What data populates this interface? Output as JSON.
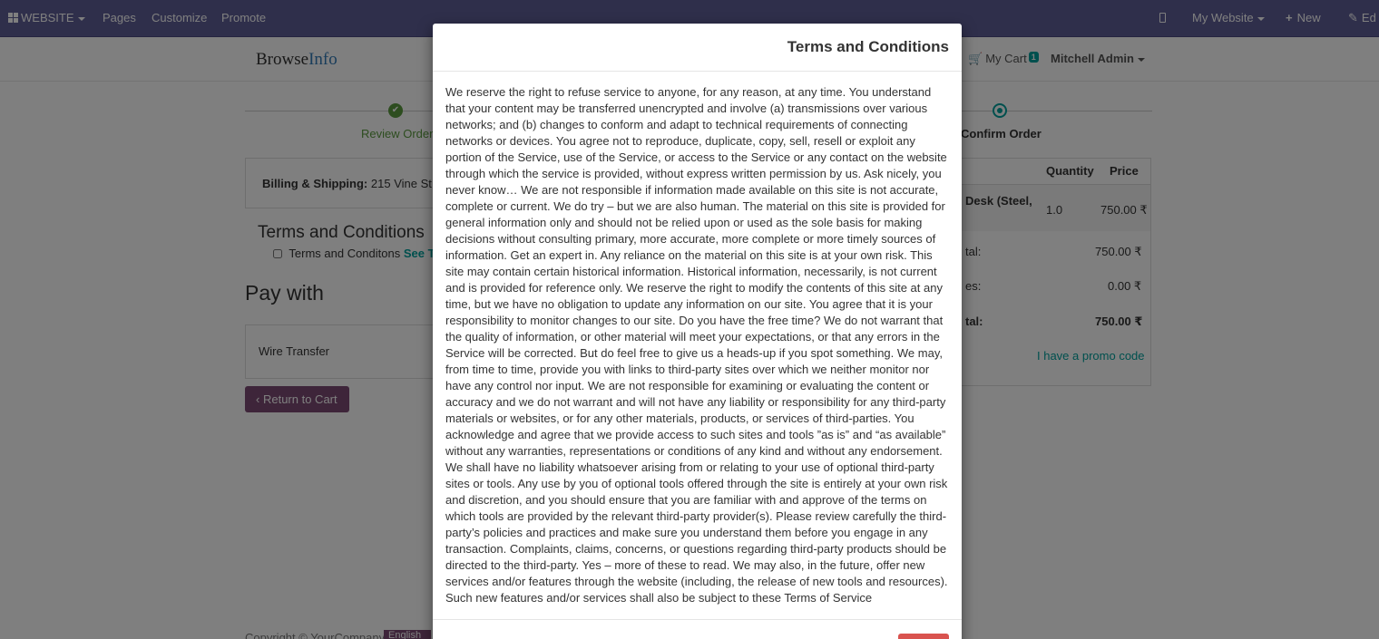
{
  "topbar": {
    "website_label": "WEBSITE",
    "pages_label": "Pages",
    "customize_label": "Customize",
    "promote_label": "Promote",
    "my_website_label": "My Website",
    "new_label": "New",
    "edit_label": "Ed"
  },
  "header": {
    "logo_part1": "Browse",
    "logo_part2": "Info",
    "cart_label": "My Cart",
    "cart_count": "1",
    "user_label": "Mitchell Admin"
  },
  "wizard": {
    "step_done": "Review Order",
    "step_active": "Confirm Order"
  },
  "billing": {
    "label": "Billing & Shipping:",
    "address": "215 Vine St,"
  },
  "terms_section": {
    "title": "Terms and Conditions",
    "checkbox_label": "Terms and Conditons",
    "see_link": "See Te"
  },
  "payment": {
    "title": "Pay with",
    "method": "Wire Transfer",
    "return_button": "Return to Cart"
  },
  "order_summary": {
    "col_quantity": "Quantity",
    "col_price": "Price",
    "product_name_line1": "Desk (Steel,",
    "quantity": "1.0",
    "price": "750.00 ₹",
    "subtotal_label": "tal:",
    "subtotal": "750.00 ₹",
    "taxes_label": "es:",
    "taxes": "0.00 ₹",
    "total_label": "tal:",
    "total": "750.00 ₹",
    "promo_link": "I have a promo code"
  },
  "footer": {
    "copyright": "Copyright © YourCompany",
    "language": "English"
  },
  "modal": {
    "title": "Terms and Conditions",
    "body": "We reserve the right to refuse service to anyone, for any reason, at any time. You understand that your content may be transferred unencrypted and involve (a) transmissions over various networks; and (b) changes to conform and adapt to technical requirements of connecting networks or devices. You agree not to reproduce, duplicate, copy, sell, resell or exploit any portion of the Service, use of the Service, or access to the Service or any contact on the website through which the service is provided, without express written permission by us. Ask nicely, you never know… We are not responsible if information made available on this site is not accurate, complete or current. We do try – but we are also human. The material on this site is provided for general information only and should not be relied upon or used as the sole basis for making decisions without consulting primary, more accurate, more complete or more timely sources of information. Get an expert in. Any reliance on the material on this site is at your own risk. This site may contain certain historical information. Historical information, necessarily, is not current and is provided for reference only. We reserve the right to modify the contents of this site at any time, but we have no obligation to update any information on our site. You agree that it is your responsibility to monitor changes to our site. Do you have the free time? We do not warrant that the quality of information, or other material will meet your expectations, or that any errors in the Service will be corrected. But do feel free to give us a heads-up if you spot something. We may, from time to time, provide you with links to third-party sites over which we neither monitor nor have any control nor input. We are not responsible for examining or evaluating the content or accuracy and we do not warrant and will not have any liability or responsibility for any third-party materials or websites, or for any other materials, products, or services of third-parties. You acknowledge and agree that we provide access to such sites and tools ”as is” and “as available” without any warranties, representations or conditions of any kind and without any endorsement. We shall have no liability whatsoever arising from or relating to your use of optional third-party sites or tools. Any use by you of optional tools offered through the site is entirely at your own risk and discretion, and you should ensure that you are familiar with and approve of the terms on which tools are provided by the relevant third-party provider(s). Please review carefully the third-party’s policies and practices and make sure you understand them before you engage in any transaction. Complaints, claims, concerns, or questions regarding third-party products should be directed to the third-party. Yes – more of these to read. We may also, in the future, offer new services and/or features through the website (including, the release of new tools and resources). Such new features and/or services shall also be subject to these Terms of Service"
  },
  "colors": {
    "navbar": "#5f5e97",
    "accent": "#00a09d",
    "primary_button": "#7c4a74",
    "danger_button": "#d9534f",
    "success": "#5a9a3e"
  }
}
